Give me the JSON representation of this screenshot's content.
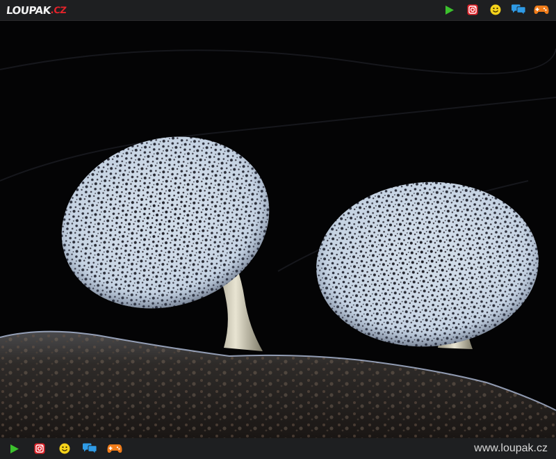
{
  "header": {
    "logo_main": "LOUPAK",
    "logo_suffix": ".CZ",
    "icons": [
      "play-icon",
      "instagram-icon",
      "smiley-icon",
      "chat-icon",
      "gamepad-icon"
    ]
  },
  "footer": {
    "icons": [
      "play-icon",
      "instagram-icon",
      "smiley-icon",
      "chat-icon",
      "gamepad-icon"
    ],
    "site_url": "www.loupak.cz"
  },
  "colors": {
    "bar": "#1e1f21",
    "play": "#3cc12d",
    "instagram": "#e2232a",
    "smiley": "#f4d21b",
    "chat": "#2f9be6",
    "gamepad": "#f07c1a"
  },
  "photo": {
    "subject": "macro photograph of two slime mold fruiting bodies on wood"
  }
}
